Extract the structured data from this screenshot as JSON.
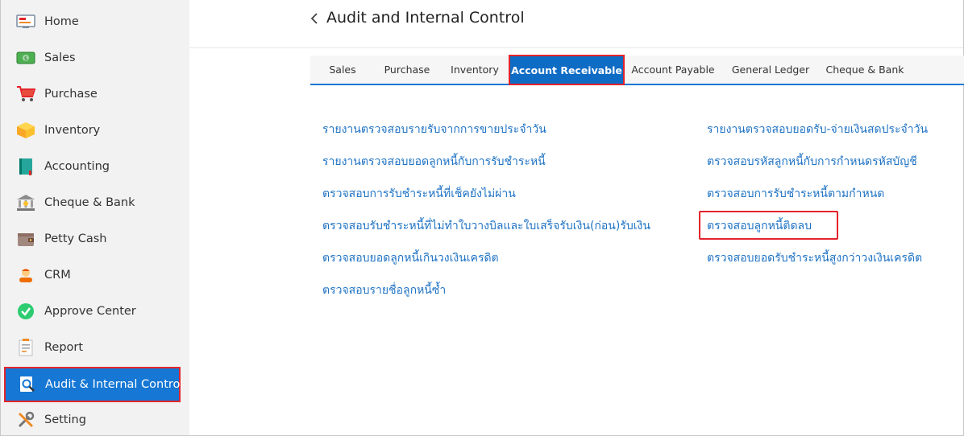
{
  "sidebar": {
    "items": [
      {
        "label": "Home",
        "icon": "home-icon"
      },
      {
        "label": "Sales",
        "icon": "money-icon"
      },
      {
        "label": "Purchase",
        "icon": "cart-icon"
      },
      {
        "label": "Inventory",
        "icon": "box-icon"
      },
      {
        "label": "Accounting",
        "icon": "book-icon"
      },
      {
        "label": "Cheque & Bank",
        "icon": "bank-icon"
      },
      {
        "label": "Petty Cash",
        "icon": "wallet-icon"
      },
      {
        "label": "CRM",
        "icon": "people-icon"
      },
      {
        "label": "Approve Center",
        "icon": "check-icon"
      },
      {
        "label": "Report",
        "icon": "report-icon"
      },
      {
        "label": "Audit & Internal Control",
        "icon": "audit-icon",
        "active": true
      },
      {
        "label": "Setting",
        "icon": "tools-icon"
      }
    ]
  },
  "header": {
    "title": "Audit and Internal Control"
  },
  "tabs": [
    {
      "label": "Sales"
    },
    {
      "label": "Purchase"
    },
    {
      "label": "Inventory"
    },
    {
      "label": "Account Receivable",
      "active": true
    },
    {
      "label": "Account Payable"
    },
    {
      "label": "General Ledger"
    },
    {
      "label": "Cheque & Bank"
    }
  ],
  "reports": {
    "left": [
      "รายงานตรวจสอบรายรับจากการขายประจำวัน",
      "รายงานตรวจสอบยอดลูกหนี้กับการรับชำระหนี้",
      "ตรวจสอบการรับชำระหนี้ที่เช็คยังไม่ผ่าน",
      "ตรวจสอบรับชำระหนี้ที่ไม่ทำใบวางบิลและใบเสร็จรับเงิน(ก่อน)รับเงิน",
      "ตรวจสอบยอดลูกหนี้เกินวงเงินเครดิต",
      "ตรวจสอบรายชื่อลูกหนี้ซ้ำ"
    ],
    "right": [
      "รายงานตรวจสอบยอดรับ-จ่ายเงินสดประจำวัน",
      "ตรวจสอบรหัสลูกหนี้กับการกำหนดรหัสบัญชี",
      "ตรวจสอบการรับชำระหนี้ตามกำหนด",
      "ตรวจสอบลูกหนี้ติดลบ",
      "ตรวจสอบยอดรับชำระหนี้สูงกว่าวงเงินเครดิต"
    ]
  },
  "colors": {
    "accent": "#1677d4",
    "highlight": "#e3242b",
    "link": "#1f73c4"
  }
}
